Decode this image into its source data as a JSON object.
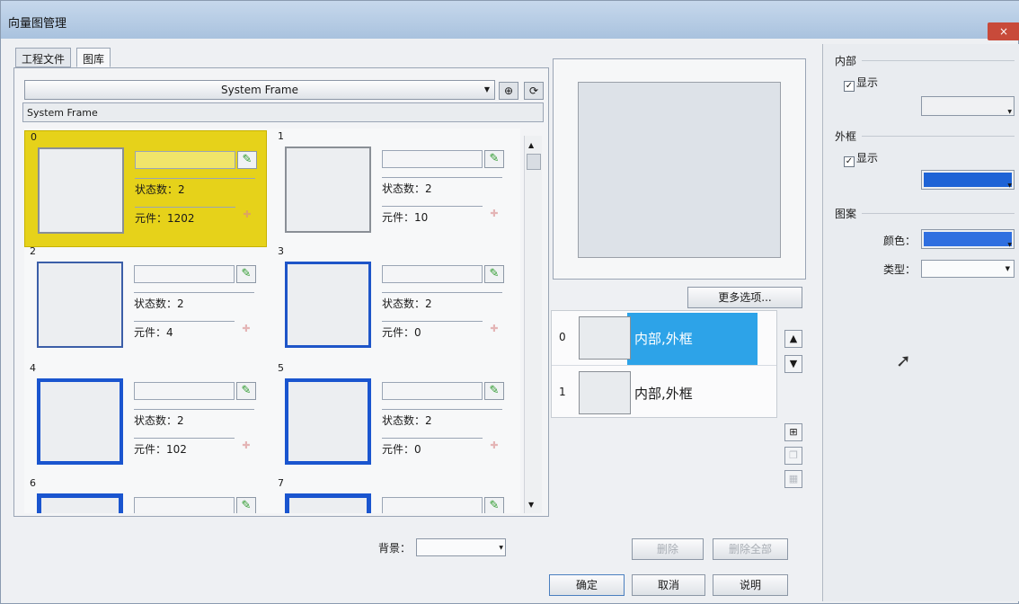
{
  "window": {
    "title": "向量图管理",
    "close": "×"
  },
  "tabs": [
    {
      "label": "工程文件"
    },
    {
      "label": "图库"
    }
  ],
  "library": {
    "selected": "System Frame",
    "name": "System Frame"
  },
  "cells": [
    {
      "index": "0",
      "states": "状态数：2",
      "parts": "元件：1202"
    },
    {
      "index": "1",
      "states": "状态数：2",
      "parts": "元件：10"
    },
    {
      "index": "2",
      "states": "状态数：2",
      "parts": "元件：4"
    },
    {
      "index": "3",
      "states": "状态数：2",
      "parts": "元件：0"
    },
    {
      "index": "4",
      "states": "状态数：2",
      "parts": "元件：102"
    },
    {
      "index": "5",
      "states": "状态数：2",
      "parts": "元件：0"
    },
    {
      "index": "6"
    },
    {
      "index": "7"
    }
  ],
  "background": {
    "label": "背景：",
    "value": ""
  },
  "preview": {
    "more_options": "更多选项..."
  },
  "layers": [
    {
      "index": "0",
      "label": "内部,外框"
    },
    {
      "index": "1",
      "label": "内部,外框"
    }
  ],
  "actions": {
    "delete": "删除",
    "delete_all": "删除全部",
    "ok": "确定",
    "cancel": "取消",
    "help": "说明"
  },
  "right": {
    "inner_title": "内部",
    "inner_show": "显示",
    "outer_title": "外框",
    "outer_show": "显示",
    "pattern_title": "图案",
    "color_label": "颜色：",
    "type_label": "类型：",
    "outer_color": "#1e63d6",
    "pattern_color": "#2f6fe0"
  }
}
